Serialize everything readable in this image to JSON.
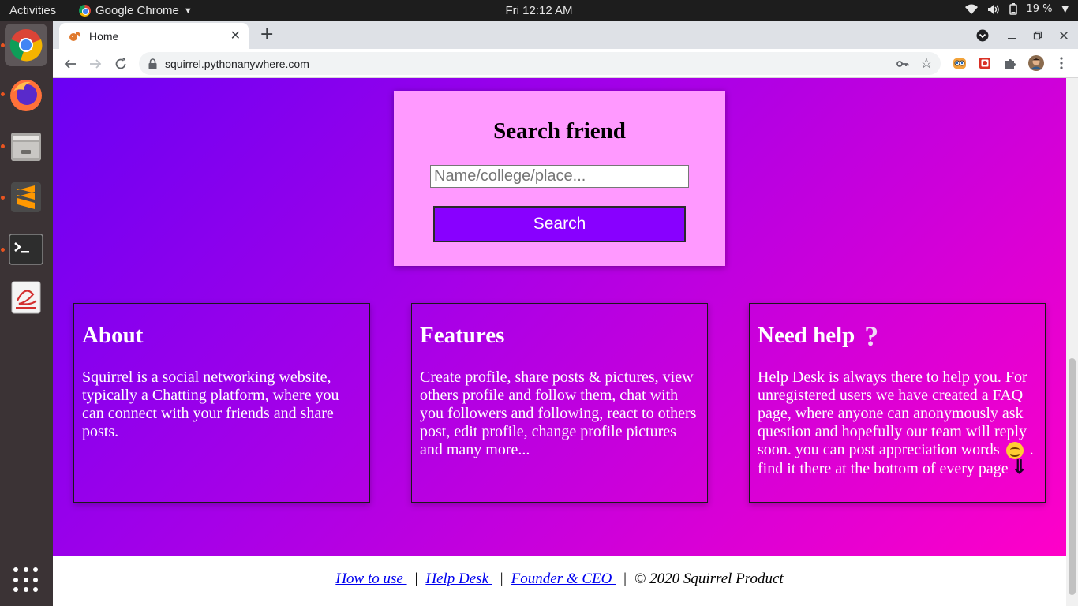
{
  "topbar": {
    "activities": "Activities",
    "app_name": "Google Chrome",
    "clock": "Fri 12:12 AM",
    "battery": "19 %"
  },
  "browser": {
    "tab_title": "Home",
    "url": "squirrel.pythonanywhere.com"
  },
  "search": {
    "title": "Search friend",
    "placeholder": "Name/college/place...",
    "button_label": "Search"
  },
  "cards": {
    "about": {
      "title": "About",
      "body": "Squirrel is a social networking website, typically a Chatting platform, where you can connect with your friends and share posts."
    },
    "features": {
      "title": "Features",
      "body": "Create profile, share posts & pictures, view others profile and follow them, chat with you followers and following, react to others post, edit profile, change profile pictures and many more..."
    },
    "help": {
      "title": "Need help",
      "body_part1": "Help Desk is always there to help you. For unregistered users we have created a FAQ page, where anyone can anonymously ask question and hopefully our team will reply soon. you can post appreciation words",
      "body_part2": ". find it there at the bottom of every page"
    }
  },
  "footer": {
    "link1": "How to use ",
    "link2": "Help Desk ",
    "link3": "Founder & CEO ",
    "separator": "|",
    "copyright": "© 2020 Squirrel Product"
  },
  "colors": {
    "gradient_start": "#6a00f4",
    "gradient_end": "#ff00c8",
    "search_card_bg": "#ff99ff",
    "search_button": "#8800ff"
  }
}
